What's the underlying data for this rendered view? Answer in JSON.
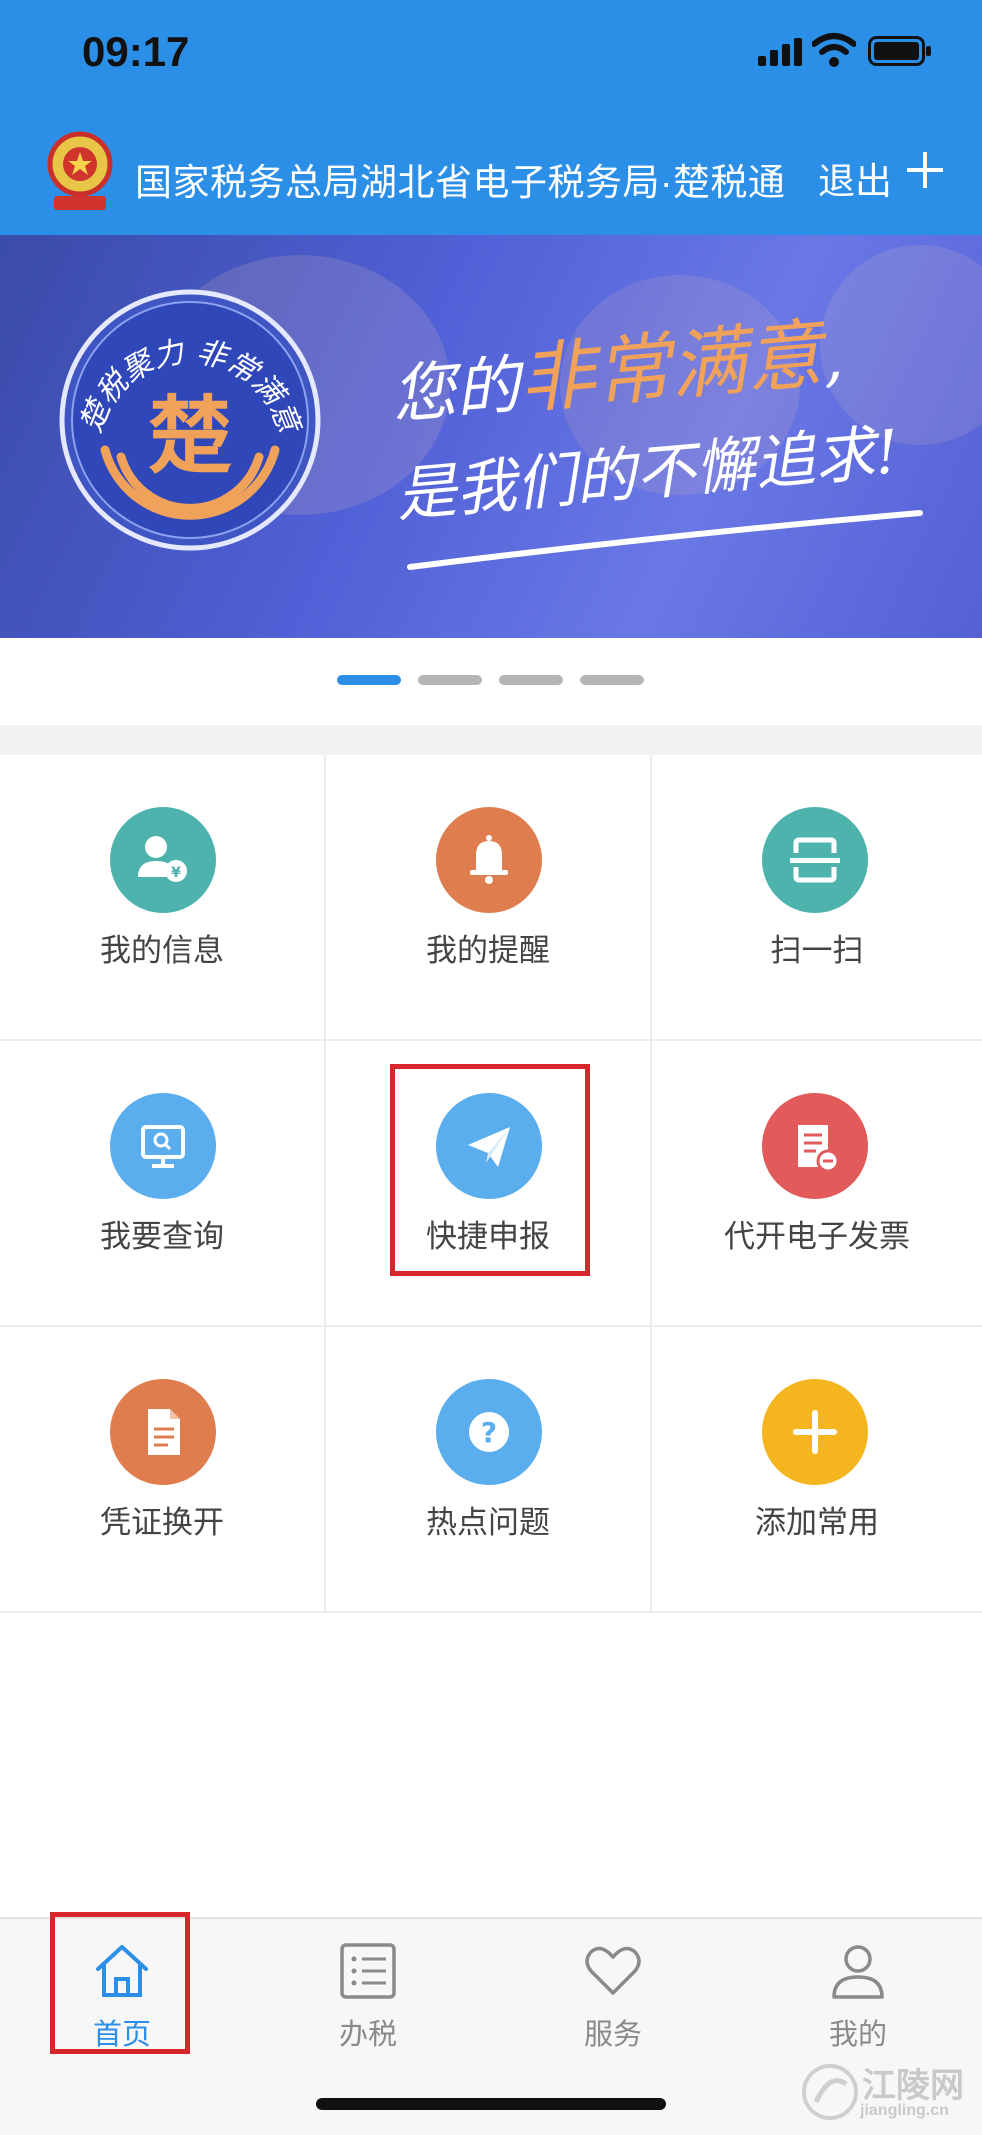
{
  "status_bar": {
    "time": "09:17"
  },
  "header": {
    "title": "国家税务总局湖北省电子税务局·楚税通",
    "logout_label": "退出",
    "plus_icon": "plus-icon"
  },
  "banner": {
    "seal_text": "楚税聚力 非常满意",
    "seal_glyph": "楚",
    "slogan_line1_a": "您的",
    "slogan_line1_b": "非常满意",
    "slogan_line1_c": ",",
    "slogan_line2": "是我们的不懈追求!",
    "colors": {
      "highlight": "#f0a25a",
      "background": "#5060d6"
    }
  },
  "carousel": {
    "count": 4,
    "active_index": 0,
    "active_color": "#2b8fe8"
  },
  "grid": {
    "items": [
      {
        "label": "我的信息",
        "icon": "user-yuan-icon",
        "color": "#4fb3ad"
      },
      {
        "label": "我的提醒",
        "icon": "bell-icon",
        "color": "#e07d4f"
      },
      {
        "label": "扫一扫",
        "icon": "scan-icon",
        "color": "#4fb3ad"
      },
      {
        "label": "我要查询",
        "icon": "monitor-search-icon",
        "color": "#5aaeee"
      },
      {
        "label": "快捷申报",
        "icon": "paper-plane-icon",
        "color": "#5aaeee"
      },
      {
        "label": "代开电子发票",
        "icon": "invoice-icon",
        "color": "#e25a5a"
      },
      {
        "label": "凭证换开",
        "icon": "document-icon",
        "color": "#e07d4f"
      },
      {
        "label": "热点问题",
        "icon": "question-icon",
        "color": "#5aaeee"
      },
      {
        "label": "添加常用",
        "icon": "plus-circle-icon",
        "color": "#f5b51f"
      }
    ]
  },
  "bottom_nav": {
    "items": [
      {
        "label": "首页",
        "icon": "home-icon",
        "active": true
      },
      {
        "label": "办税",
        "icon": "list-icon",
        "active": false
      },
      {
        "label": "服务",
        "icon": "heart-icon",
        "active": false
      },
      {
        "label": "我的",
        "icon": "person-icon",
        "active": false
      }
    ]
  },
  "watermark": {
    "text": "江陵网",
    "sub": "jiangling.cn"
  }
}
